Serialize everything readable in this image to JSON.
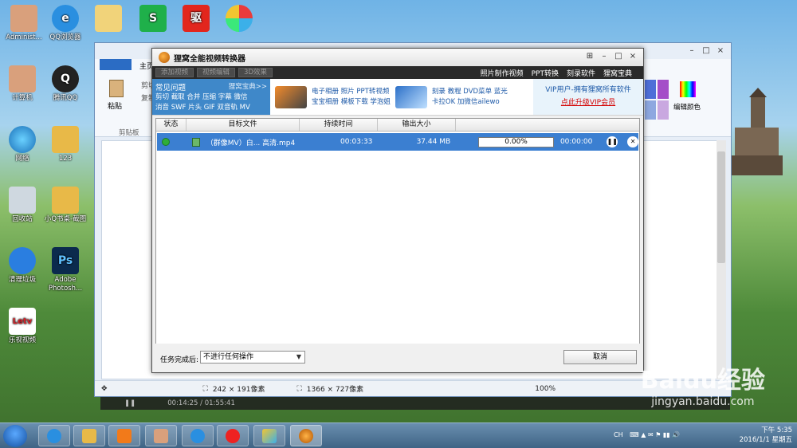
{
  "desktop": {
    "icons": [
      {
        "label": "Administ..."
      },
      {
        "label": "QQ浏览器"
      },
      {
        "label": "计算机"
      },
      {
        "label": "腾讯QQ"
      },
      {
        "label": "网络"
      },
      {
        "label": "123"
      },
      {
        "label": "回收站"
      },
      {
        "label": "小Q书桌-截图"
      },
      {
        "label": "清理垃圾"
      },
      {
        "label": "Adobe Photosh..."
      },
      {
        "label": "乐视视频"
      }
    ]
  },
  "bg_window": {
    "ribbon_home_tab": "主页",
    "paste_label": "粘贴",
    "cut_label": "剪切",
    "copy_label": "复制",
    "clipboard_group": "剪贴板",
    "edit_color_label": "编辑颜色",
    "status_selection": "242 × 191像素",
    "status_size": "1366 × 727像素",
    "zoom": "100%"
  },
  "converter": {
    "title": "狸窝全能视频转换器",
    "toolbar": {
      "add_video": "添加视频",
      "video_edit": "视频编辑",
      "effects": "3D效果"
    },
    "top_links": [
      "照片制作视频",
      "PPT转换",
      "刻录软件",
      "狸窝宝典"
    ],
    "banner": {
      "faq_title": "常见问题",
      "faq_more": "狸窝宝典>>",
      "faq_line1": "剪切 截取 合并 压缩 字幕 微信",
      "faq_line2": "消音 SWF 片头 GIF 双音轨 MV",
      "promo1_line1": "电子相册 照片 PPT转视频",
      "promo1_line2": "宝宝相册 模板下载 学泡姐",
      "promo2_line1": "刻录 教程 DVD菜单 蓝光",
      "promo2_line2": "卡拉OK 加微信ailewo",
      "vip_line1": "VIP用户-拥有狸窝所有软件",
      "vip_line2": "点此升级VIP会员"
    },
    "table": {
      "headers": [
        "状态",
        "目标文件",
        "持续时间",
        "输出大小"
      ],
      "rows": [
        {
          "file": "（群像MV）白... 高清.mp4",
          "duration": "00:03:33",
          "size": "37.44 MB",
          "progress": "0.00%",
          "elapsed": "00:00:00"
        }
      ]
    },
    "footer": {
      "after_label": "任务完成后:",
      "after_value": "不进行任何操作",
      "cancel": "取消"
    }
  },
  "mediabar": {
    "time": "00:14:25 / 01:55:41"
  },
  "watermark": {
    "brand": "Baidu经验",
    "url": "jingyan.baidu.com"
  },
  "taskbar": {
    "time": "下午 5:35",
    "date": "2016/1/1 星期五",
    "lang": "CH"
  },
  "colors": {
    "row_selected": "#3b7fd1",
    "faq_bg": "#3f88c9",
    "vip_link": "#d40000",
    "toolbar_bg": "#2a2a2a"
  }
}
